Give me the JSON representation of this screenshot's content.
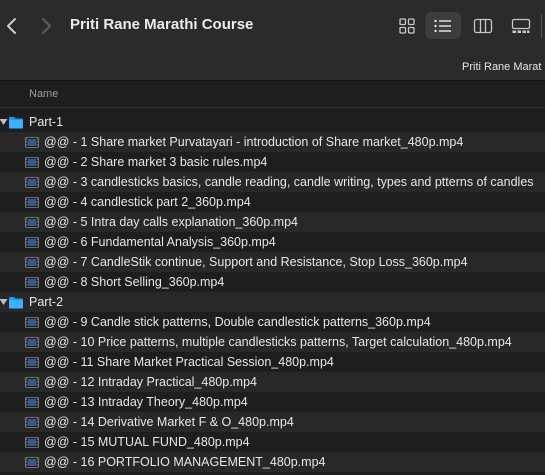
{
  "window": {
    "title": "Priti Rane Marathi Course"
  },
  "path_bar": {
    "label": "Priti Rane Marat"
  },
  "columns": {
    "name": "Name"
  },
  "folders": [
    {
      "name": "Part-1",
      "files": [
        "@@ - 1 Share market Purvatayari - introduction of Share market_480p.mp4",
        "@@ - 2  Share market 3 basic rules.mp4",
        "@@ - 3  candlesticks basics, candle reading, candle writing, types and ptterns of candles",
        "@@ - 4  candlestick part 2_360p.mp4",
        "@@ - 5  Intra day calls explanation_360p.mp4",
        "@@ - 6  Fundamental Analysis_360p.mp4",
        "@@ - 7   CandleStik continue, Support and Resistance, Stop Loss_360p.mp4",
        "@@ - 8 Short Selling_360p.mp4"
      ]
    },
    {
      "name": "Part-2",
      "files": [
        "@@ - 9 Candle stick patterns, Double candlestick patterns_360p.mp4",
        "@@ - 10 Price patterns, multiple candlesticks patterns, Target calculation_480p.mp4",
        "@@ - 11 Share Market Practical Session_480p.mp4",
        "@@ - 12 Intraday Practical_480p.mp4",
        "@@ - 13 Intraday Theory_480p.mp4",
        "@@ - 14 Derivative Market F & O_480p.mp4",
        "@@ - 15 MUTUAL FUND_480p.mp4",
        "@@ - 16 PORTFOLIO MANAGEMENT_480p.mp4"
      ]
    }
  ],
  "colors": {
    "background": "#1e1e1e",
    "toolbar": "#2b2b2b",
    "row_alt": "#282828",
    "folder_blue": "#1e9bf0",
    "text": "#e6e6e6"
  },
  "icons": [
    "back-chevron-icon",
    "forward-chevron-icon",
    "icon-view-icon",
    "list-view-icon",
    "column-view-icon",
    "gallery-view-icon",
    "disclosure-triangle-icon",
    "folder-icon",
    "movie-file-icon"
  ]
}
